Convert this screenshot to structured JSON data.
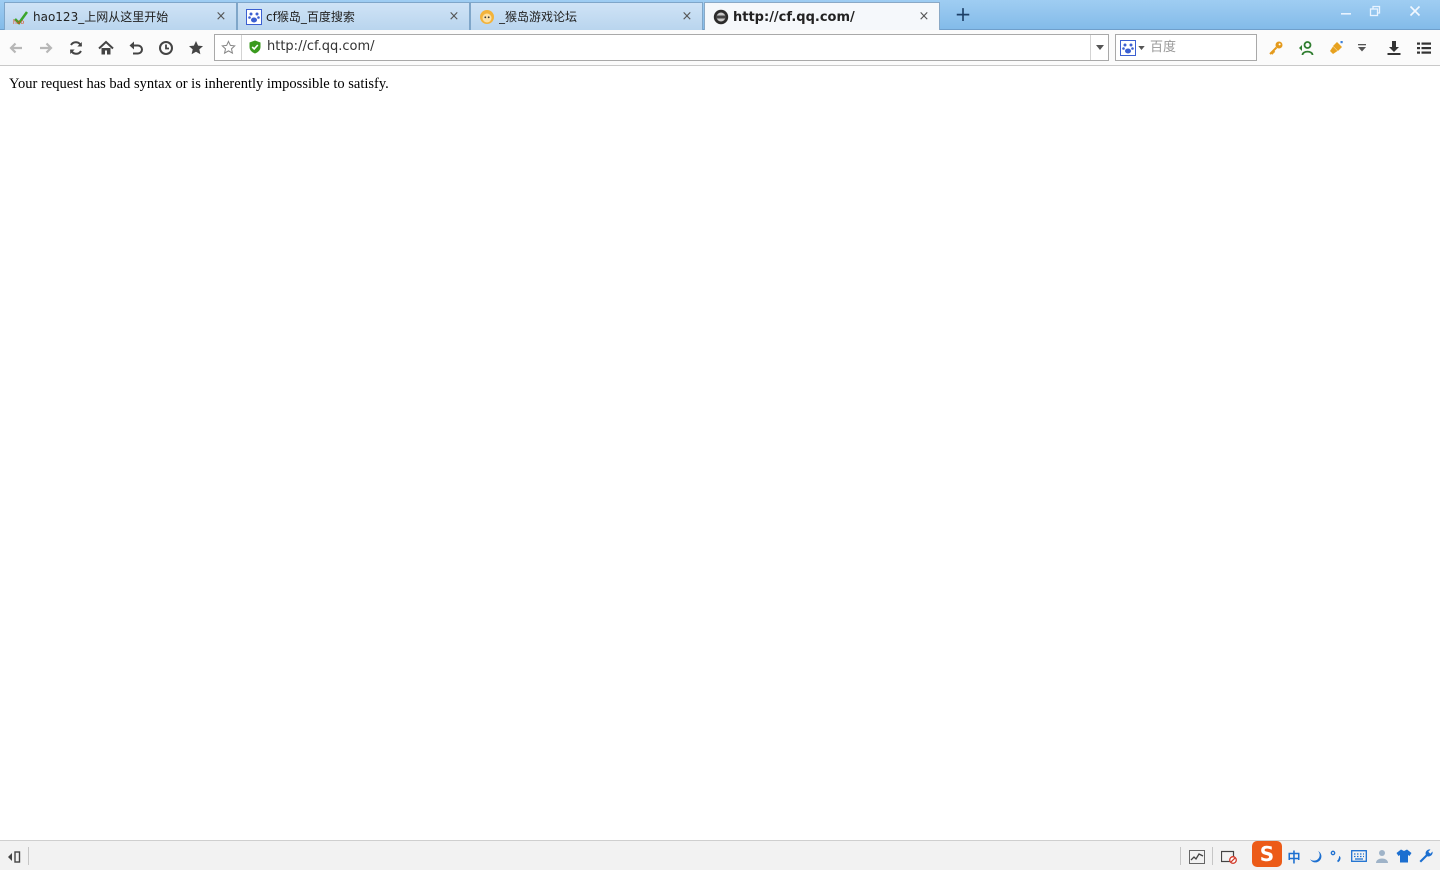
{
  "tabs": [
    {
      "title": "hao123_上网从这里开始",
      "icon": "hao123-icon",
      "active": false
    },
    {
      "title": "cf猴岛_百度搜索",
      "icon": "baidu-paw-icon",
      "active": false
    },
    {
      "title": "_猴岛游戏论坛",
      "icon": "monkey-icon",
      "active": false
    },
    {
      "title": "http://cf.qq.com/",
      "icon": "site-icon",
      "active": true
    }
  ],
  "tab_close_glyph": "×",
  "new_tab_glyph": "+",
  "address": {
    "url": "http://cf.qq.com/"
  },
  "search": {
    "placeholder": "百度",
    "engine_icon": "baidu-paw-icon"
  },
  "page": {
    "message": "Your request has bad syntax or is inherently impossible to satisfy."
  },
  "status": {
    "ime_logo": "S",
    "ime_mode": "中"
  },
  "colors": {
    "tabstrip": "#9fcdf2",
    "ime_brand": "#ec5b18",
    "shield": "#3a9a1e"
  }
}
